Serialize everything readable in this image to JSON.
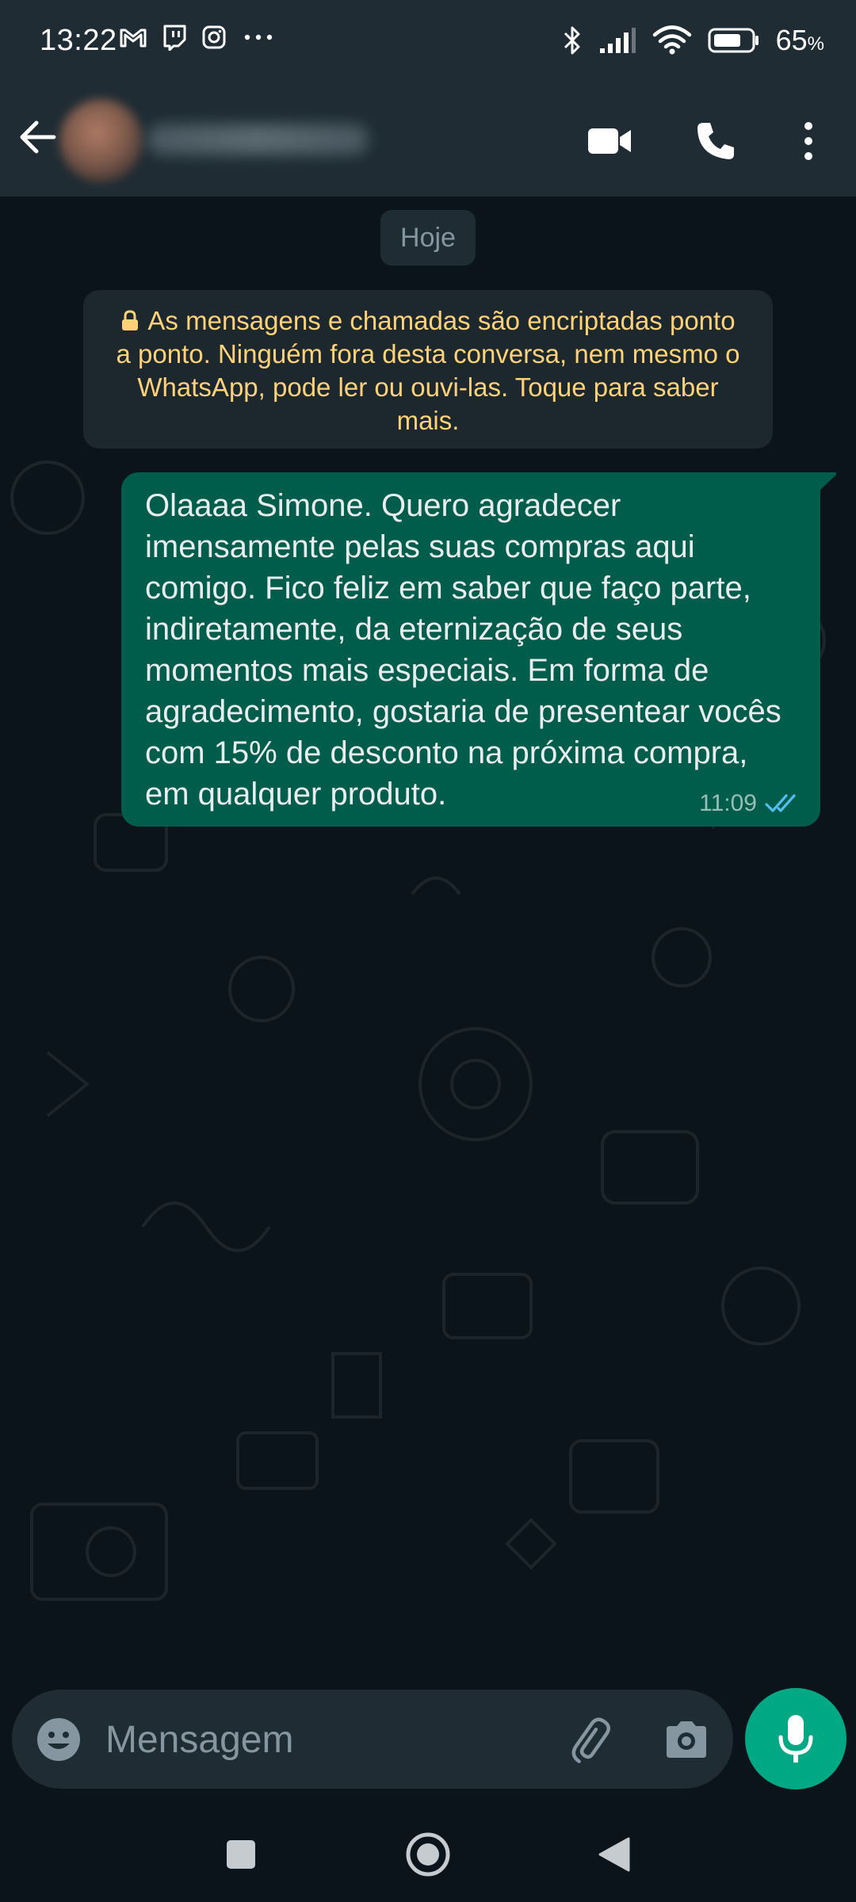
{
  "status_bar": {
    "time": "13:22",
    "battery_percent": "65",
    "battery_symbol": "%",
    "notification_icons": [
      "gmail-icon",
      "twitch-icon",
      "instagram-icon",
      "more-dots-icon"
    ],
    "system_icons": [
      "bluetooth-icon",
      "signal-icon",
      "wifi-icon",
      "battery-icon"
    ]
  },
  "header": {
    "icons": [
      "back-arrow-icon",
      "video-call-icon",
      "phone-call-icon",
      "overflow-menu-icon"
    ]
  },
  "chat": {
    "date_label": "Hoje",
    "encryption_notice": "As mensagens e chamadas são encriptadas ponto a ponto. Ninguém fora desta conversa, nem mesmo o WhatsApp, pode ler ou ouvi-las. Toque para saber mais.",
    "messages": [
      {
        "direction": "outgoing",
        "text": "Olaaaa Simone. Quero agradecer imensamente pelas suas compras aqui comigo. Fico feliz em saber que faço parte, indiretamente, da eternização de seus momentos mais especiais. Em forma de agradecimento, gostaria de presentear vocês com 15% de desconto na próxima compra, em qualquer produto.",
        "time": "11:09",
        "status": "read"
      }
    ]
  },
  "composer": {
    "placeholder": "Mensagem"
  },
  "colors": {
    "background": "#0b141a",
    "header": "#1f2c34",
    "outgoing_bubble": "#005c4b",
    "accent": "#00a884",
    "notice_text": "#ffd279",
    "read_ticks": "#53bdeb"
  }
}
